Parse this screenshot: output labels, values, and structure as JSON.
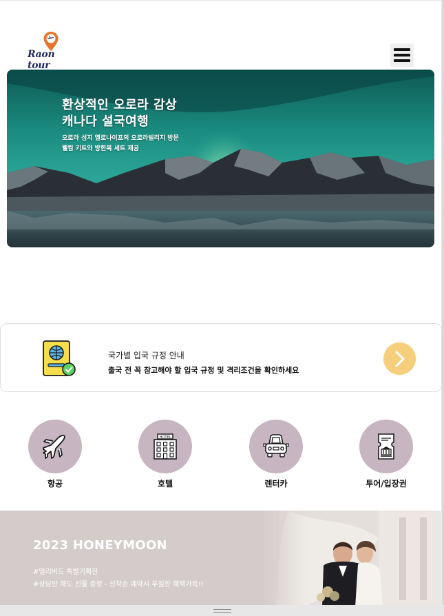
{
  "header": {
    "logo_text": "Raon tour",
    "menu_icon": "hamburger-menu-icon"
  },
  "banner": {
    "title_line1": "환상적인 오로라 감상",
    "title_line2": "캐나다 설국여행",
    "sub_line1": "오로라 성지 옐로나이프의 오로라빌리지 방문",
    "sub_line2": "웰컴 키트와 방한복 세트 제공"
  },
  "entry_info": {
    "title": "국가별 입국 규정 안내",
    "description": "출국 전 꼭 참고해야 할 입국 규정 및 격리조건을 확인하세요",
    "icon": "passport-icon",
    "arrow_icon": "chevron-right-icon",
    "arrow_color": "#f6cf7d"
  },
  "categories": [
    {
      "label": "항공",
      "icon": "airplane-icon"
    },
    {
      "label": "호텔",
      "icon": "hotel-icon"
    },
    {
      "label": "렌터카",
      "icon": "car-icon"
    },
    {
      "label": "투어/입장권",
      "icon": "ticket-icon"
    }
  ],
  "honeymoon": {
    "title": "2023 HONEYMOON",
    "line1": "#얼리버드 특별기획전",
    "line2": "#상담만 해도 선물 증정 - 선착순 예약시 푸짐한 혜택가득!!"
  },
  "colors": {
    "category_circle": "#c7b5c2",
    "honeymoon_bg": "#d3cccb",
    "logo_text": "#1f2a5a",
    "logo_pin": "#e8732c"
  }
}
